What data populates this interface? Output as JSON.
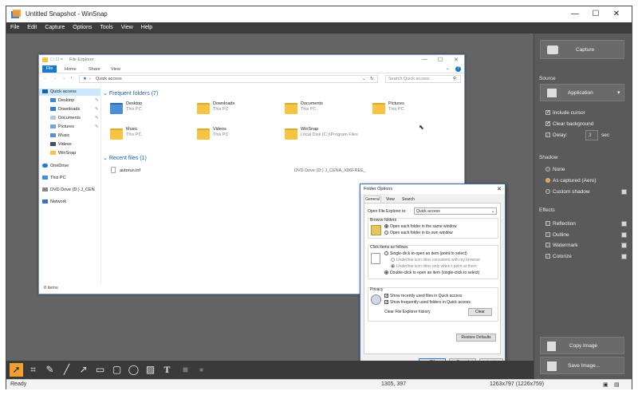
{
  "window": {
    "title": "Untitled Snapshot - WinSnap",
    "minimize": "—",
    "maximize": "☐",
    "close": "✕"
  },
  "menu": [
    "File",
    "Edit",
    "Capture",
    "Options",
    "Tools",
    "View",
    "Help"
  ],
  "explorer": {
    "title": "File Explorer",
    "tabs": [
      "File",
      "Home",
      "Share",
      "View"
    ],
    "address": "Quick access",
    "search_placeholder": "Search Quick access",
    "nav": {
      "quick_access": "Quick access",
      "items": [
        "Desktop",
        "Downloads",
        "Documents",
        "Pictures",
        "Music",
        "Videos",
        "WinSnap"
      ],
      "onedrive": "OneDrive",
      "this_pc": "This PC",
      "dvd": "DVD Drive (D:) J_CEN",
      "network": "Network"
    },
    "frequent_header": "Frequent folders (7)",
    "folders": [
      {
        "name": "Desktop",
        "sub": "This PC"
      },
      {
        "name": "Downloads",
        "sub": "This PC"
      },
      {
        "name": "Documents",
        "sub": "This PC"
      },
      {
        "name": "Pictures",
        "sub": "This PC"
      },
      {
        "name": "Music",
        "sub": "This PC"
      },
      {
        "name": "Videos",
        "sub": "This PC"
      },
      {
        "name": "WinSnap",
        "sub": "Local Disk (C:)\\Program Files"
      }
    ],
    "recent_header": "Recent files (1)",
    "recent_file": "autorun.inf",
    "recent_location": "DVD Drive (D:) J_CENA_X86FREE_",
    "status": "8 items"
  },
  "dialog": {
    "title": "Folder Options",
    "tabs": [
      "General",
      "View",
      "Search"
    ],
    "open_label": "Open File Explorer to:",
    "open_value": "Quick access",
    "browse_header": "Browse folders",
    "browse_opt1": "Open each folder in the same window",
    "browse_opt2": "Open each folder in its own window",
    "click_header": "Click items as follows",
    "click_opt1": "Single-click to open an item (point to select)",
    "click_sub1": "Underline icon titles consistent with my browser",
    "click_sub2": "Underline icon titles only when I point at them",
    "click_opt2": "Double-click to open an item (single-click to select)",
    "privacy_header": "Privacy",
    "privacy_chk1": "Show recently used files in Quick access",
    "privacy_chk2": "Show frequently used folders in Quick access",
    "clear_label": "Clear File Explorer history",
    "clear_btn": "Clear",
    "restore_btn": "Restore Defaults",
    "ok": "OK",
    "cancel": "Cancel",
    "apply": "Apply"
  },
  "panel": {
    "capture": "Capture",
    "source_header": "Source",
    "source_value": "Application",
    "include_cursor": "Include cursor",
    "clear_background": "Clear background",
    "delay_label": "Delay:",
    "delay_value": "3",
    "delay_unit": "sec",
    "shadow_header": "Shadow",
    "shadow_none": "None",
    "shadow_as_captured": "As captured (Aero)",
    "shadow_custom": "Custom shadow",
    "effects_header": "Effects",
    "effects": [
      "Reflection",
      "Outline",
      "Watermark",
      "Colorize"
    ],
    "copy_image": "Copy Image",
    "save_image": "Save Image..."
  },
  "status": {
    "left": "Ready",
    "coords": "1305, 397",
    "size": "1263x797 (1226x759)"
  },
  "colors": {
    "canvas": "#646464",
    "panel": "#5a5a5a",
    "menubar": "#3c3c3c",
    "accent_orange": "#f0a030",
    "explorer_blue": "#1f5fa8"
  }
}
